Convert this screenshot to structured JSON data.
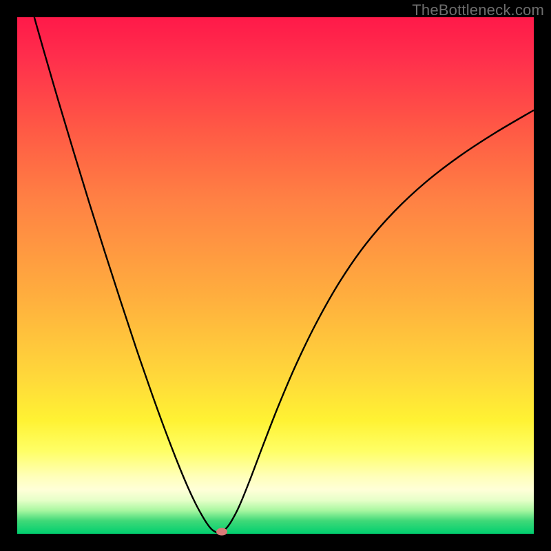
{
  "watermark": "TheBottleneck.com",
  "colors": {
    "page_bg": "#000000",
    "curve_stroke": "#000000",
    "marker_fill": "#d97b78"
  },
  "chart_data": {
    "type": "line",
    "title": "",
    "xlabel": "",
    "ylabel": "",
    "xlim": [
      0,
      100
    ],
    "ylim": [
      0,
      100
    ],
    "curve_points": [
      {
        "x": 3.3,
        "y": 100.0
      },
      {
        "x": 5.0,
        "y": 94.0
      },
      {
        "x": 8.0,
        "y": 83.7
      },
      {
        "x": 11.0,
        "y": 73.7
      },
      {
        "x": 14.0,
        "y": 63.9
      },
      {
        "x": 17.0,
        "y": 54.4
      },
      {
        "x": 20.0,
        "y": 45.1
      },
      {
        "x": 23.0,
        "y": 36.0
      },
      {
        "x": 26.0,
        "y": 27.3
      },
      {
        "x": 28.5,
        "y": 20.4
      },
      {
        "x": 31.0,
        "y": 13.9
      },
      {
        "x": 33.0,
        "y": 9.1
      },
      {
        "x": 34.5,
        "y": 5.9
      },
      {
        "x": 35.8,
        "y": 3.5
      },
      {
        "x": 36.8,
        "y": 1.9
      },
      {
        "x": 37.6,
        "y": 0.9
      },
      {
        "x": 38.3,
        "y": 0.4
      },
      {
        "x": 39.0,
        "y": 0.2
      },
      {
        "x": 39.7,
        "y": 0.45
      },
      {
        "x": 40.5,
        "y": 1.1
      },
      {
        "x": 41.5,
        "y": 2.5
      },
      {
        "x": 43.0,
        "y": 5.4
      },
      {
        "x": 45.0,
        "y": 10.3
      },
      {
        "x": 47.5,
        "y": 16.9
      },
      {
        "x": 50.5,
        "y": 24.6
      },
      {
        "x": 54.0,
        "y": 32.8
      },
      {
        "x": 58.0,
        "y": 41.0
      },
      {
        "x": 62.5,
        "y": 48.9
      },
      {
        "x": 67.5,
        "y": 56.1
      },
      {
        "x": 73.0,
        "y": 62.4
      },
      {
        "x": 79.0,
        "y": 68.0
      },
      {
        "x": 85.5,
        "y": 73.0
      },
      {
        "x": 92.5,
        "y": 77.6
      },
      {
        "x": 100.0,
        "y": 82.0
      }
    ],
    "marker": {
      "x": 39.6,
      "y": 0.4
    }
  }
}
